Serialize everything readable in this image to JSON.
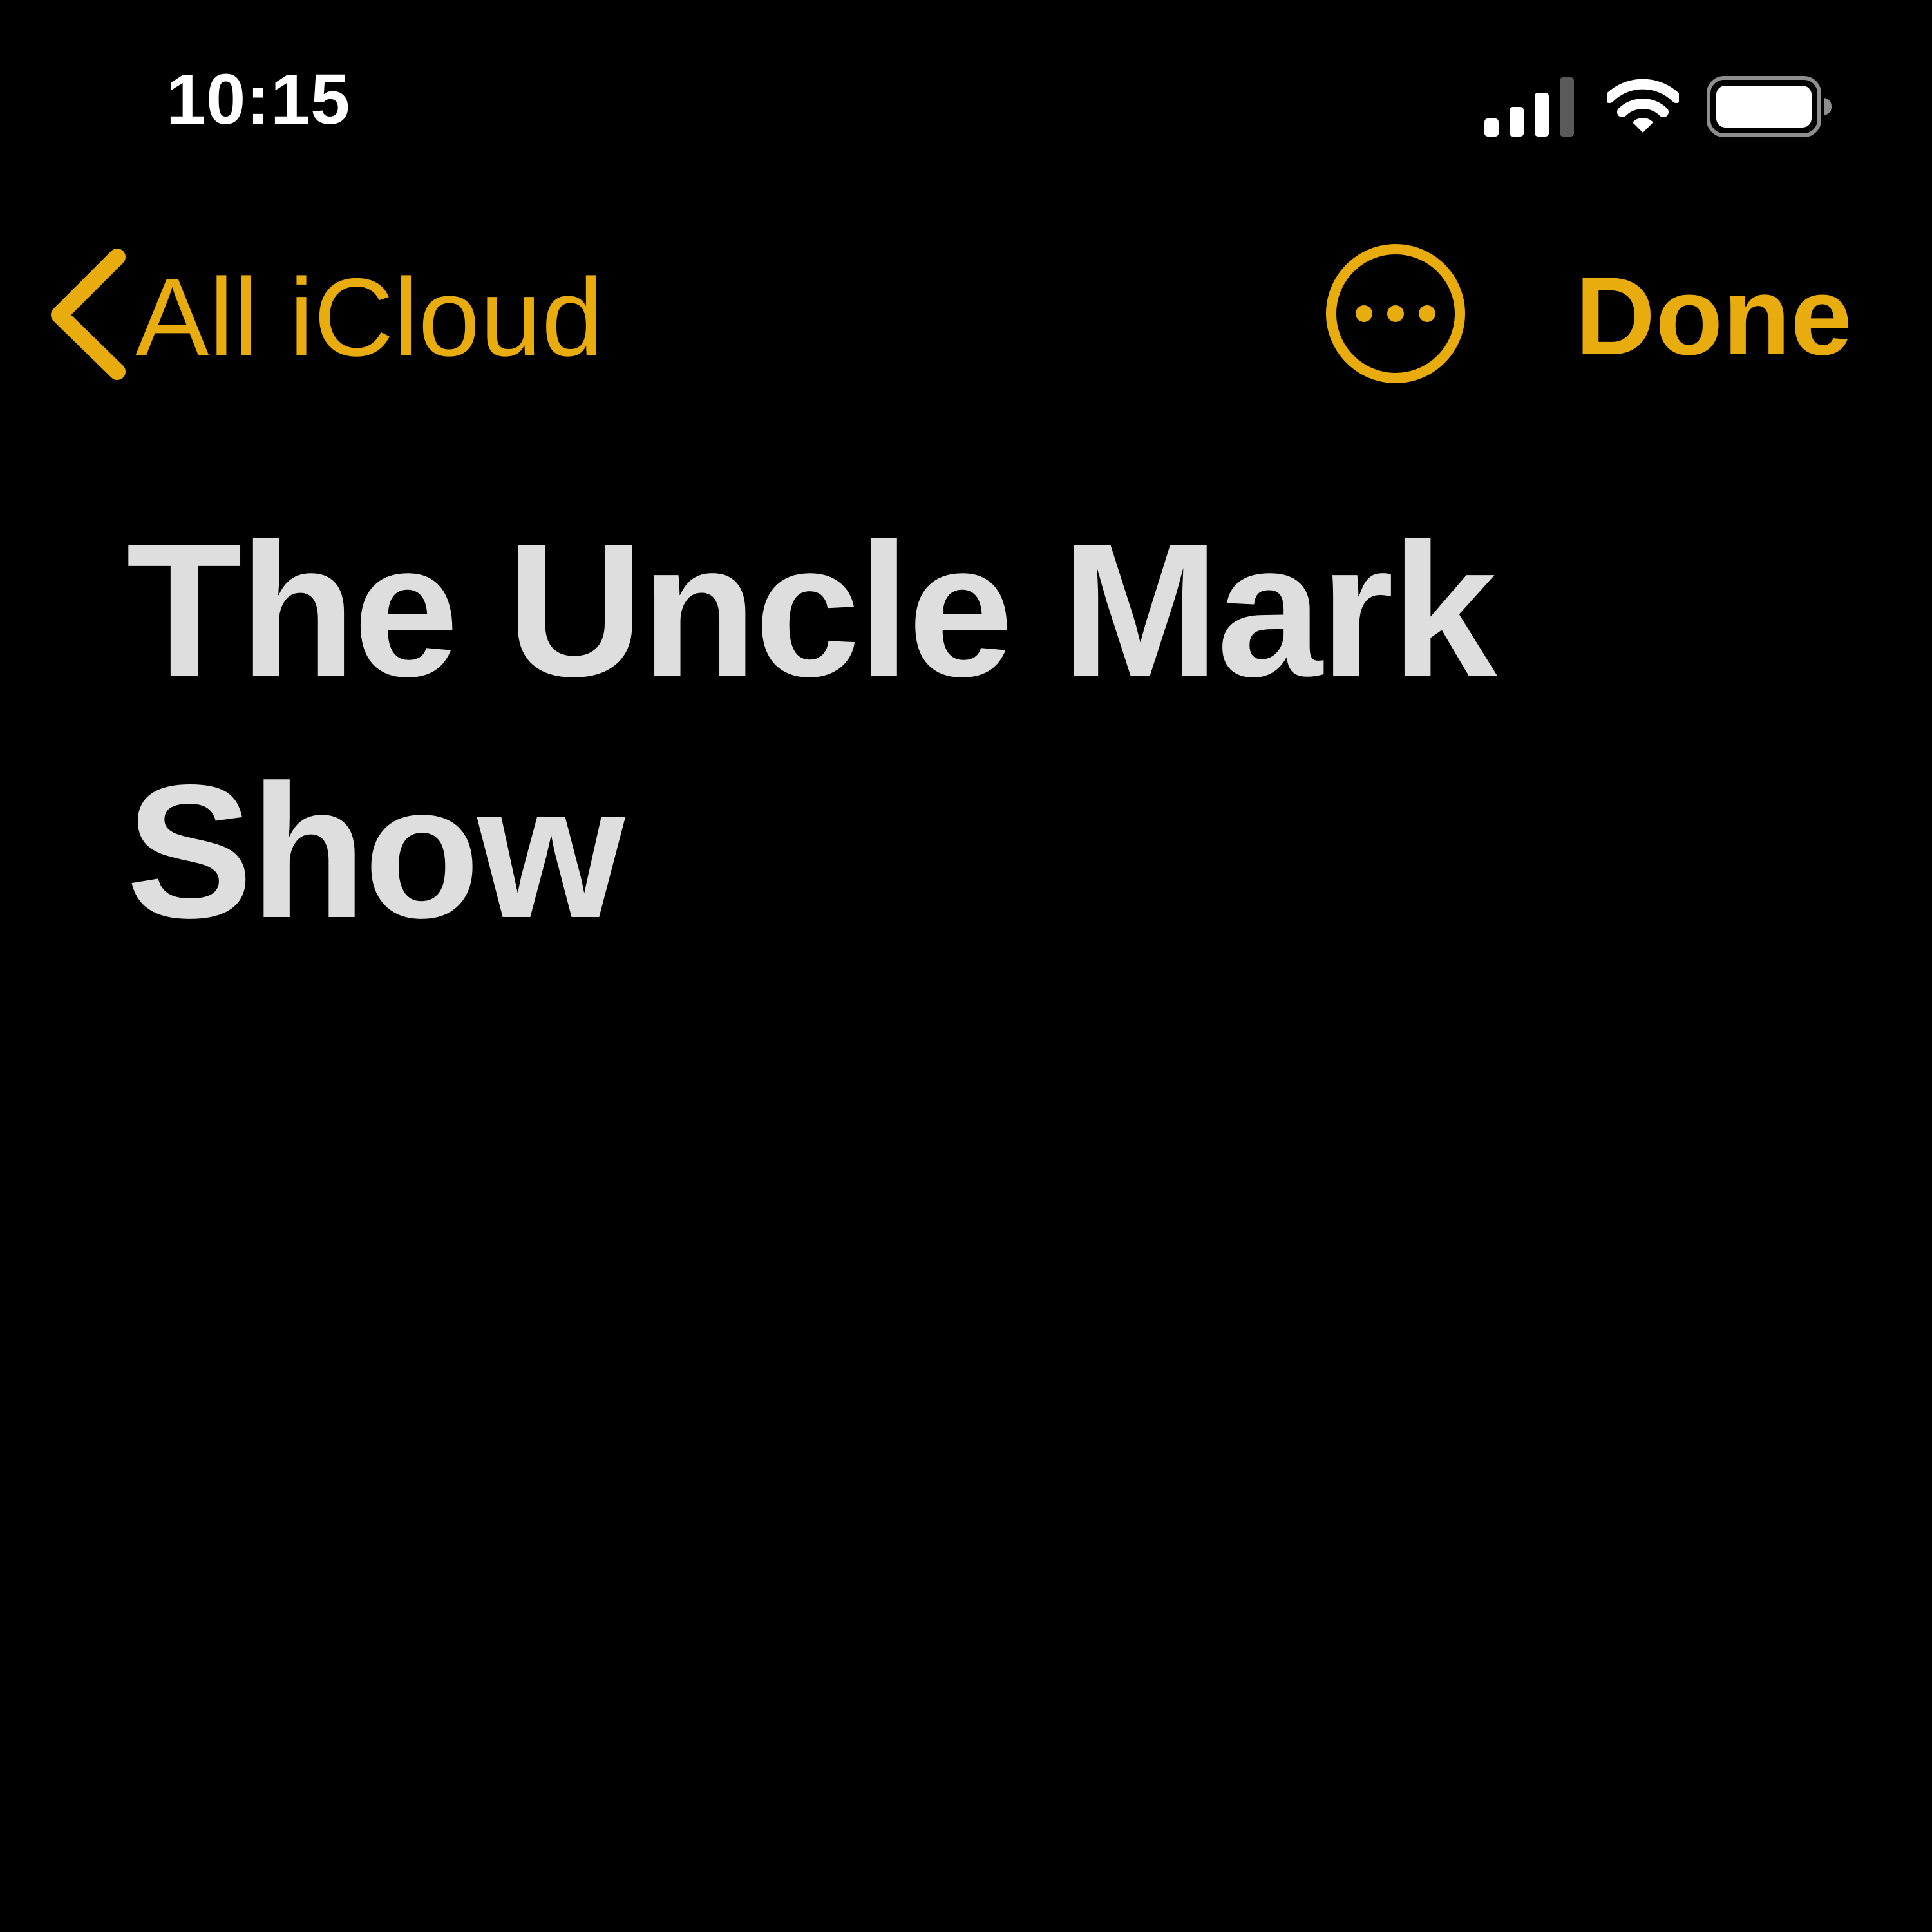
{
  "status_bar": {
    "time": "10:15",
    "icons": [
      "cellular-signal-icon",
      "wifi-icon",
      "battery-icon"
    ]
  },
  "nav": {
    "back_label": "All iCloud",
    "back_icon": "chevron-left-icon",
    "more_icon": "ellipsis-circle-icon",
    "done_label": "Done"
  },
  "note": {
    "title": "The Uncle Mark Show"
  },
  "colors": {
    "accent": "#E8AC0F",
    "background": "#000000",
    "title_text": "#DEDEDE",
    "status_text": "#FFFFFF"
  }
}
